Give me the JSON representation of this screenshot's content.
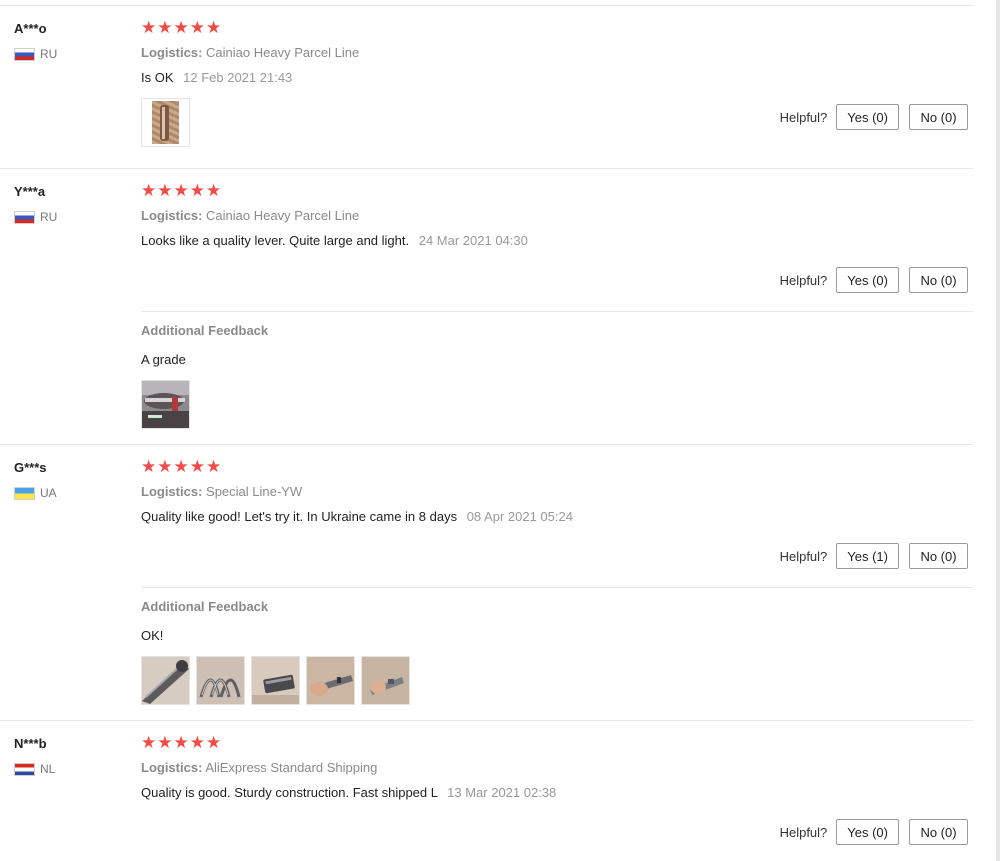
{
  "helpful_label": "Helpful?",
  "star_color": "#f44b46",
  "reviews": [
    {
      "user": "A***o",
      "country": "RU",
      "flag": "russia-flag",
      "rating": 5,
      "logistics_label": "Logistics:",
      "logistics": "Cainiao Heavy Parcel Line",
      "text": "Is OK",
      "date": "12 Feb 2021 21:43",
      "yes_label": "Yes (0)",
      "no_label": "No (0)"
    },
    {
      "user": "Y***a",
      "country": "RU",
      "flag": "russia-flag",
      "rating": 5,
      "logistics_label": "Logistics:",
      "logistics": "Cainiao Heavy Parcel Line",
      "text": "Looks like a quality lever. Quite large and light.",
      "date": "24 Mar 2021 04:30",
      "yes_label": "Yes (0)",
      "no_label": "No (0)",
      "additional": {
        "title": "Additional Feedback",
        "text": "A grade"
      }
    },
    {
      "user": "G***s",
      "country": "UA",
      "flag": "ukraine-flag",
      "rating": 5,
      "logistics_label": "Logistics:",
      "logistics": "Special Line-YW",
      "text": "Quality like good! Let's try it. In Ukraine came in 8 days",
      "date": "08 Apr 2021 05:24",
      "yes_label": "Yes (1)",
      "no_label": "No (0)",
      "additional": {
        "title": "Additional Feedback",
        "text": "OK!"
      }
    },
    {
      "user": "N***b",
      "country": "NL",
      "flag": "netherlands-flag",
      "rating": 5,
      "logistics_label": "Logistics:",
      "logistics": "AliExpress Standard Shipping",
      "text": "Quality is good. Sturdy construction. Fast shipped L",
      "date": "13 Mar 2021 02:38",
      "yes_label": "Yes (0)",
      "no_label": "No (0)"
    }
  ]
}
